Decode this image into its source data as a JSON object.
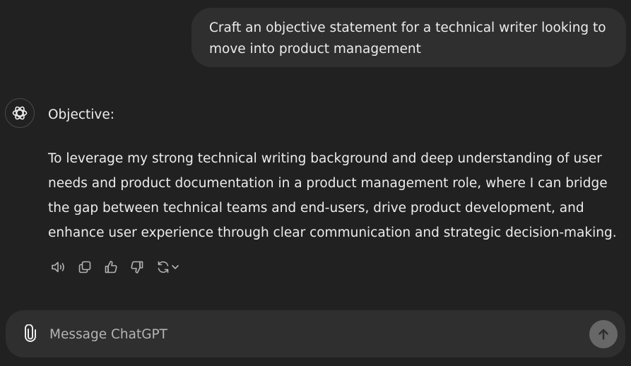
{
  "conversation": {
    "user_message": "Craft an objective statement for a technical writer looking to move into product management",
    "assistant_heading": "Objective:",
    "assistant_body": "To leverage my strong technical writing background and deep understanding of user needs and product documentation in a product management role, where I can bridge the gap between technical teams and end-users, drive product development, and enhance user experience through clear communication and strategic decision-making."
  },
  "actions": [
    {
      "icon": "speaker-icon"
    },
    {
      "icon": "copy-icon"
    },
    {
      "icon": "thumbs-up-icon"
    },
    {
      "icon": "thumbs-down-icon"
    },
    {
      "icon": "regenerate-icon"
    }
  ],
  "composer": {
    "placeholder": "Message ChatGPT",
    "value": ""
  },
  "colors": {
    "background": "#212121",
    "bubble": "#2f2f2f",
    "text": "#ececec",
    "icon": "#b4b4b4",
    "send_button": "#676767"
  }
}
